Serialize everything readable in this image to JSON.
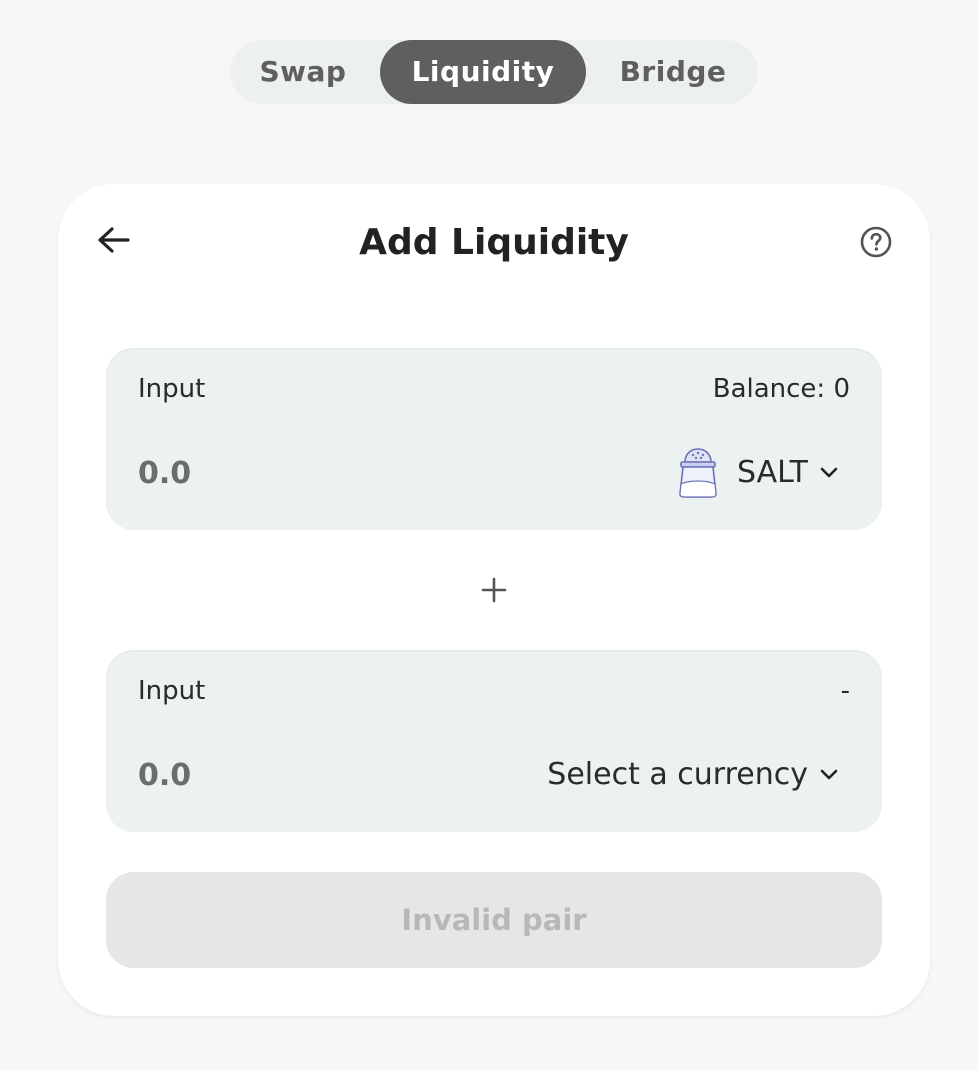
{
  "tabs": [
    {
      "label": "Swap",
      "active": false
    },
    {
      "label": "Liquidity",
      "active": true
    },
    {
      "label": "Bridge",
      "active": false
    }
  ],
  "card": {
    "title": "Add Liquidity",
    "back_icon": "arrow-left-icon",
    "help_icon": "question-circle-icon"
  },
  "input_a": {
    "label": "Input",
    "balance": "Balance: 0",
    "placeholder": "0.0",
    "currency": "SALT",
    "currency_icon": "salt-shaker-icon"
  },
  "plus_icon": "plus-icon",
  "input_b": {
    "label": "Input",
    "balance": "-",
    "placeholder": "0.0",
    "currency": "Select a currency"
  },
  "submit": {
    "label": "Invalid pair",
    "disabled": true
  },
  "colors": {
    "page_background": "#f7f7f7",
    "tab_active_bg": "#5f5f5f",
    "panel_bg": "#ecf1f1",
    "button_disabled_bg": "#e6e6e8",
    "button_disabled_text": "#b8b8b8"
  }
}
